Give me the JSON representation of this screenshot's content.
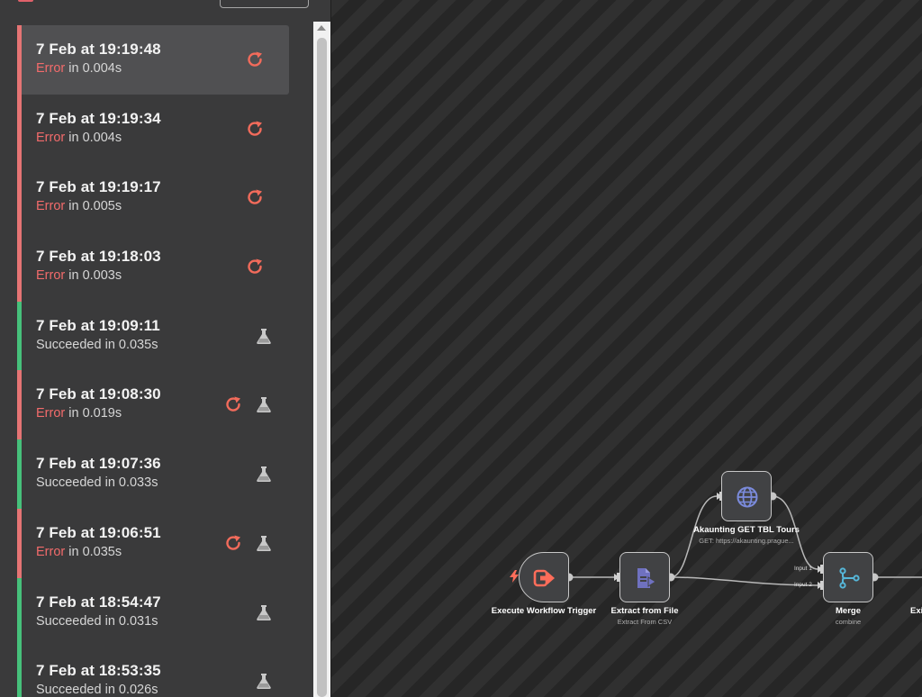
{
  "sidebar": {
    "executions": [
      {
        "time": "7 Feb at 19:19:48",
        "status_word": "Error",
        "status_rest": " in 0.004s",
        "state": "error",
        "retry": true,
        "debug": false,
        "selected": true
      },
      {
        "time": "7 Feb at 19:19:34",
        "status_word": "Error",
        "status_rest": " in 0.004s",
        "state": "error",
        "retry": true,
        "debug": false
      },
      {
        "time": "7 Feb at 19:19:17",
        "status_word": "Error",
        "status_rest": " in 0.005s",
        "state": "error",
        "retry": true,
        "debug": false
      },
      {
        "time": "7 Feb at 19:18:03",
        "status_word": "Error",
        "status_rest": " in 0.003s",
        "state": "error",
        "retry": true,
        "debug": false
      },
      {
        "time": "7 Feb at 19:09:11",
        "status_word": "Succeeded",
        "status_rest": " in 0.035s",
        "state": "success",
        "retry": false,
        "debug": true
      },
      {
        "time": "7 Feb at 19:08:30",
        "status_word": "Error",
        "status_rest": " in 0.019s",
        "state": "error",
        "retry": true,
        "debug": true
      },
      {
        "time": "7 Feb at 19:07:36",
        "status_word": "Succeeded",
        "status_rest": " in 0.033s",
        "state": "success",
        "retry": false,
        "debug": true
      },
      {
        "time": "7 Feb at 19:06:51",
        "status_word": "Error",
        "status_rest": " in 0.035s",
        "state": "error",
        "retry": true,
        "debug": true
      },
      {
        "time": "7 Feb at 18:54:47",
        "status_word": "Succeeded",
        "status_rest": " in 0.031s",
        "state": "success",
        "retry": false,
        "debug": true
      },
      {
        "time": "7 Feb at 18:53:35",
        "status_word": "Succeeded",
        "status_rest": " in 0.026s",
        "state": "success",
        "retry": false,
        "debug": true
      }
    ]
  },
  "workflow": {
    "nodes": {
      "trigger": {
        "title": "Execute Workflow Trigger",
        "subtitle": "",
        "icon": "sign-in-icon"
      },
      "extract": {
        "title": "Extract from File",
        "subtitle": "Extract From CSV",
        "icon": "file-export-icon"
      },
      "http": {
        "title": "Akaunting GET TBL Tours",
        "subtitle": "GET: https://akaunting.prague...",
        "icon": "globe-icon"
      },
      "merge": {
        "title": "Merge",
        "subtitle": "combine",
        "icon": "merge-icon",
        "input1": "Input 1",
        "input2": "Input 2"
      },
      "exit": {
        "title": "Exi"
      }
    }
  },
  "colors": {
    "error": "#e57474",
    "success": "#46c07b",
    "retry_icon": "#f26b5b",
    "trigger_icon": "#ff6d5a",
    "extract_icon": "#6f71c0",
    "http_icon": "#7b8bdc",
    "merge_icon": "#56b7d9"
  }
}
